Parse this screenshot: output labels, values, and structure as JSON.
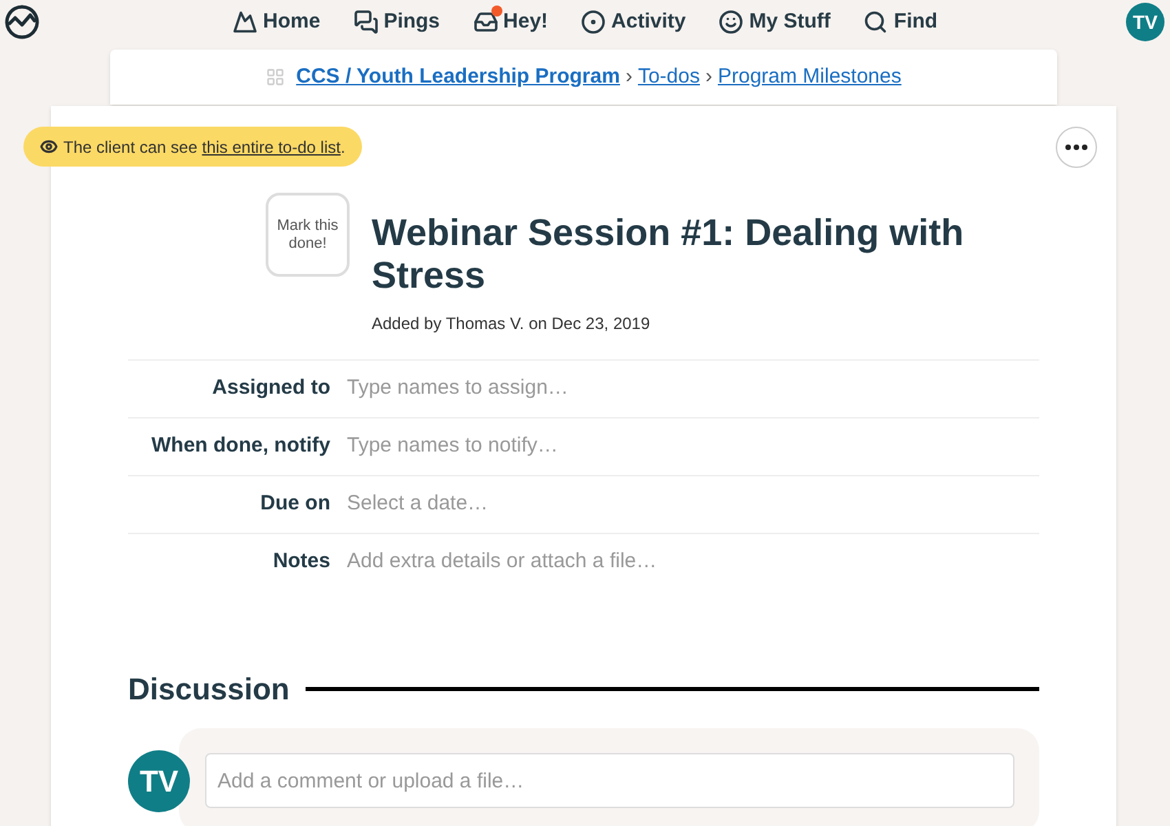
{
  "nav": [
    {
      "kind": "home",
      "label": "Home",
      "notification": false
    },
    {
      "kind": "pings",
      "label": "Pings",
      "notification": false
    },
    {
      "kind": "hey",
      "label": "Hey!",
      "notification": true
    },
    {
      "kind": "activity",
      "label": "Activity",
      "notification": false
    },
    {
      "kind": "stuff",
      "label": "My Stuff",
      "notification": false
    },
    {
      "kind": "find",
      "label": "Find",
      "notification": false
    }
  ],
  "user": {
    "initials": "TV"
  },
  "breadcrumb": [
    {
      "label": "CCS / Youth Leadership Program",
      "bold": true
    },
    {
      "label": "To-dos",
      "bold": false
    },
    {
      "label": "Program Milestones",
      "bold": false
    }
  ],
  "breadcrumb_separator": "›",
  "visibility": {
    "text": "The client can see ",
    "link": "this entire to-do list",
    "end": "."
  },
  "todo": {
    "done_label": "Mark this done!",
    "title": "Webinar Session #1: Dealing with Stress",
    "meta": "Added by Thomas V. on Dec 23, 2019"
  },
  "fields": [
    {
      "label": "Assigned to",
      "placeholder": "Type names to assign…"
    },
    {
      "label": "When done, notify",
      "placeholder": "Type names to notify…"
    },
    {
      "label": "Due on",
      "placeholder": "Select a date…"
    },
    {
      "label": "Notes",
      "placeholder": "Add extra details or attach a file…"
    }
  ],
  "discussion": {
    "heading": "Discussion",
    "avatar": "TV",
    "placeholder": "Add a comment or upload a file…"
  }
}
